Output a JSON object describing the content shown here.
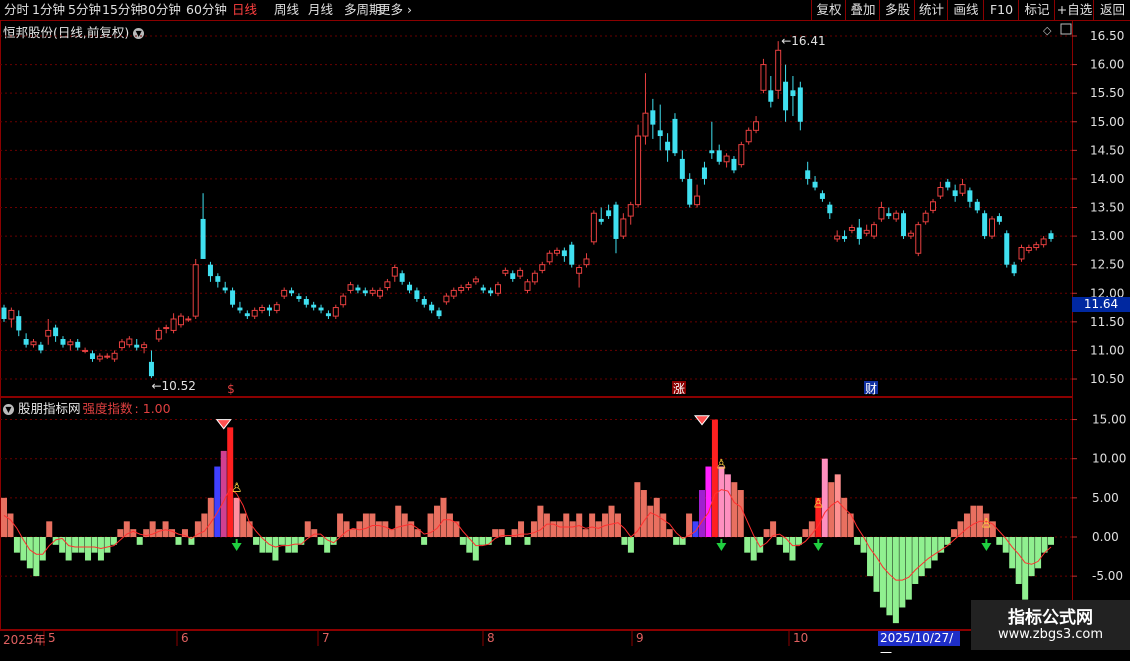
{
  "toolbar": {
    "periods": [
      "分时",
      "1分钟",
      "5分钟",
      "15分钟",
      "30分钟",
      "60分钟",
      "日线",
      "周线",
      "月线",
      "多周期",
      "更多"
    ],
    "active_period": "日线",
    "right_buttons": [
      "复权",
      "叠加",
      "多股",
      "统计",
      "画线",
      "F10",
      "标记",
      "+自选",
      "返回"
    ]
  },
  "header": {
    "stock_name": "恒邦股份",
    "mode": "(日线,前复权)"
  },
  "indicator": {
    "name": "股朋指标网",
    "series_name": "强度指数",
    "value": "1.00"
  },
  "price_panel": {
    "yticks": [
      "16.50",
      "16.00",
      "15.50",
      "15.00",
      "14.50",
      "14.00",
      "13.50",
      "13.00",
      "12.50",
      "12.00",
      "11.50",
      "11.00",
      "10.50"
    ],
    "current_price": "11.64",
    "high_label": "16.41",
    "low_label": "10.52",
    "event_marks": [
      "$",
      "涨",
      "财"
    ]
  },
  "indicator_panel": {
    "yticks": [
      "15.00",
      "10.00",
      "5.00",
      "0.00",
      "-5.00"
    ]
  },
  "dates": {
    "year_label": "2025年",
    "months": [
      "5",
      "6",
      "7",
      "8",
      "9",
      "10"
    ],
    "cursor": "2025/10/27/一"
  },
  "watermark": {
    "title": "指标公式网",
    "url": "www.zbgs3.com"
  },
  "colors": {
    "up": "#e84040",
    "down": "#40e0f0",
    "pos_bar": "#e87060",
    "neg_bar": "#90f090",
    "grid": "#7a0000"
  },
  "chart_data": [
    {
      "type": "candlestick",
      "title": "恒邦股份(日线,前复权)",
      "ylim": [
        10.3,
        16.7
      ],
      "grid": true,
      "candles": [
        [
          11.75,
          11.55,
          11.8,
          11.5
        ],
        [
          11.55,
          11.7,
          11.75,
          11.4
        ],
        [
          11.6,
          11.35,
          11.7,
          11.25
        ],
        [
          11.2,
          11.1,
          11.3,
          11.05
        ],
        [
          11.1,
          11.15,
          11.2,
          11.05
        ],
        [
          11.1,
          11.0,
          11.15,
          10.95
        ],
        [
          11.25,
          11.35,
          11.55,
          11.1
        ],
        [
          11.4,
          11.25,
          11.45,
          11.15
        ],
        [
          11.2,
          11.1,
          11.25,
          11.05
        ],
        [
          11.1,
          11.15,
          11.2,
          11.0
        ],
        [
          11.15,
          11.05,
          11.2,
          11.0
        ],
        [
          11.0,
          11.0,
          11.05,
          10.95
        ],
        [
          10.95,
          10.85,
          11.0,
          10.8
        ],
        [
          10.85,
          10.9,
          10.95,
          10.8
        ],
        [
          10.9,
          10.9,
          10.95,
          10.85
        ],
        [
          10.85,
          10.95,
          11.0,
          10.8
        ],
        [
          11.05,
          11.15,
          11.2,
          11.0
        ],
        [
          11.1,
          11.2,
          11.25,
          11.05
        ],
        [
          11.1,
          11.05,
          11.2,
          11.0
        ],
        [
          11.05,
          11.1,
          11.15,
          10.95
        ],
        [
          10.8,
          10.55,
          11.0,
          10.52
        ],
        [
          11.2,
          11.35,
          11.4,
          11.15
        ],
        [
          11.4,
          11.4,
          11.45,
          11.3
        ],
        [
          11.35,
          11.55,
          11.65,
          11.3
        ],
        [
          11.45,
          11.6,
          11.65,
          11.4
        ],
        [
          11.55,
          11.55,
          11.6,
          11.5
        ],
        [
          11.6,
          12.5,
          12.6,
          11.55
        ],
        [
          13.3,
          12.6,
          13.75,
          12.6
        ],
        [
          12.5,
          12.3,
          12.55,
          12.2
        ],
        [
          12.3,
          12.2,
          12.35,
          12.1
        ],
        [
          12.1,
          12.05,
          12.2,
          12.0
        ],
        [
          12.05,
          11.8,
          12.1,
          11.75
        ],
        [
          11.75,
          11.7,
          11.85,
          11.65
        ],
        [
          11.65,
          11.6,
          11.7,
          11.55
        ],
        [
          11.6,
          11.7,
          11.75,
          11.55
        ],
        [
          11.7,
          11.75,
          11.8,
          11.65
        ],
        [
          11.75,
          11.7,
          11.8,
          11.6
        ],
        [
          11.7,
          11.8,
          11.85,
          11.65
        ],
        [
          11.95,
          12.05,
          12.1,
          11.9
        ],
        [
          12.05,
          12.0,
          12.1,
          11.95
        ],
        [
          11.95,
          11.9,
          12.0,
          11.85
        ],
        [
          11.9,
          11.8,
          11.95,
          11.75
        ],
        [
          11.8,
          11.75,
          11.85,
          11.7
        ],
        [
          11.75,
          11.7,
          11.8,
          11.65
        ],
        [
          11.65,
          11.6,
          11.7,
          11.55
        ],
        [
          11.6,
          11.75,
          11.8,
          11.55
        ],
        [
          11.8,
          11.95,
          12.0,
          11.75
        ],
        [
          12.05,
          12.15,
          12.2,
          12.0
        ],
        [
          12.1,
          12.05,
          12.15,
          12.0
        ],
        [
          12.05,
          12.0,
          12.1,
          11.95
        ],
        [
          12.0,
          12.05,
          12.1,
          11.95
        ],
        [
          11.95,
          12.05,
          12.1,
          11.9
        ],
        [
          12.1,
          12.2,
          12.25,
          12.05
        ],
        [
          12.3,
          12.45,
          12.5,
          12.2
        ],
        [
          12.35,
          12.2,
          12.4,
          12.15
        ],
        [
          12.15,
          12.05,
          12.2,
          12.0
        ],
        [
          12.05,
          11.9,
          12.1,
          11.85
        ],
        [
          11.9,
          11.8,
          11.95,
          11.75
        ],
        [
          11.8,
          11.7,
          11.85,
          11.65
        ],
        [
          11.7,
          11.6,
          11.75,
          11.55
        ],
        [
          11.85,
          11.95,
          12.0,
          11.8
        ],
        [
          11.95,
          12.05,
          12.1,
          11.9
        ],
        [
          12.05,
          12.1,
          12.15,
          12.0
        ],
        [
          12.1,
          12.15,
          12.2,
          12.05
        ],
        [
          12.2,
          12.25,
          12.3,
          12.15
        ],
        [
          12.1,
          12.05,
          12.15,
          12.0
        ],
        [
          12.05,
          12.0,
          12.1,
          11.95
        ],
        [
          12.0,
          12.15,
          12.2,
          11.95
        ],
        [
          12.35,
          12.4,
          12.45,
          12.3
        ],
        [
          12.35,
          12.25,
          12.4,
          12.2
        ],
        [
          12.3,
          12.4,
          12.45,
          12.25
        ],
        [
          12.05,
          12.2,
          12.25,
          12.0
        ],
        [
          12.2,
          12.35,
          12.4,
          12.15
        ],
        [
          12.4,
          12.5,
          12.55,
          12.35
        ],
        [
          12.55,
          12.7,
          12.75,
          12.5
        ],
        [
          12.7,
          12.75,
          12.8,
          12.65
        ],
        [
          12.75,
          12.65,
          12.8,
          12.55
        ],
        [
          12.85,
          12.5,
          12.9,
          12.45
        ],
        [
          12.35,
          12.45,
          12.5,
          12.1
        ],
        [
          12.5,
          12.6,
          12.7,
          12.45
        ],
        [
          12.9,
          13.4,
          13.45,
          12.85
        ],
        [
          13.3,
          13.25,
          13.5,
          13.2
        ],
        [
          13.45,
          13.35,
          13.55,
          13.3
        ],
        [
          13.55,
          12.95,
          13.6,
          12.7
        ],
        [
          13.0,
          13.3,
          13.4,
          12.95
        ],
        [
          13.35,
          13.55,
          13.6,
          13.2
        ],
        [
          13.55,
          14.75,
          14.95,
          13.5
        ],
        [
          14.75,
          15.15,
          15.85,
          14.6
        ],
        [
          15.2,
          14.95,
          15.4,
          14.7
        ],
        [
          14.85,
          14.75,
          15.3,
          14.5
        ],
        [
          14.65,
          14.5,
          14.8,
          14.3
        ],
        [
          15.05,
          14.45,
          15.15,
          14.4
        ],
        [
          14.35,
          14.0,
          14.5,
          13.95
        ],
        [
          14.0,
          13.55,
          14.1,
          13.5
        ],
        [
          13.55,
          13.7,
          13.9,
          13.5
        ],
        [
          14.2,
          14.0,
          14.3,
          13.9
        ],
        [
          14.5,
          14.45,
          15.0,
          14.35
        ],
        [
          14.5,
          14.3,
          14.6,
          14.25
        ],
        [
          14.3,
          14.4,
          14.45,
          14.2
        ],
        [
          14.35,
          14.15,
          14.4,
          14.1
        ],
        [
          14.25,
          14.6,
          14.65,
          14.2
        ],
        [
          14.65,
          14.85,
          14.9,
          14.6
        ],
        [
          14.85,
          15.0,
          15.1,
          14.8
        ],
        [
          15.55,
          16.0,
          16.1,
          15.5
        ],
        [
          15.55,
          15.35,
          15.8,
          15.25
        ],
        [
          15.55,
          16.25,
          16.41,
          15.4
        ],
        [
          15.7,
          15.2,
          16.0,
          15.0
        ],
        [
          15.55,
          15.45,
          15.8,
          15.1
        ],
        [
          15.6,
          15.0,
          15.7,
          14.85
        ],
        [
          14.15,
          14.0,
          14.3,
          13.9
        ],
        [
          13.95,
          13.85,
          14.05,
          13.8
        ],
        [
          13.75,
          13.65,
          13.8,
          13.6
        ],
        [
          13.55,
          13.4,
          13.6,
          13.3
        ],
        [
          12.95,
          13.0,
          13.1,
          12.9
        ],
        [
          13.0,
          12.95,
          13.1,
          12.9
        ],
        [
          13.1,
          13.15,
          13.2,
          13.05
        ],
        [
          13.15,
          12.95,
          13.3,
          12.85
        ],
        [
          13.05,
          13.1,
          13.2,
          13.0
        ],
        [
          13.0,
          13.2,
          13.25,
          12.95
        ],
        [
          13.3,
          13.5,
          13.6,
          13.25
        ],
        [
          13.4,
          13.35,
          13.5,
          13.3
        ],
        [
          13.3,
          13.4,
          13.45,
          13.25
        ],
        [
          13.4,
          13.0,
          13.45,
          12.95
        ],
        [
          13.0,
          13.05,
          13.1,
          12.95
        ],
        [
          12.7,
          13.2,
          13.25,
          12.65
        ],
        [
          13.25,
          13.4,
          13.45,
          13.2
        ],
        [
          13.45,
          13.6,
          13.65,
          13.4
        ],
        [
          13.7,
          13.85,
          13.95,
          13.65
        ],
        [
          13.95,
          13.85,
          14.0,
          13.8
        ],
        [
          13.8,
          13.7,
          13.9,
          13.6
        ],
        [
          13.75,
          13.9,
          14.0,
          13.7
        ],
        [
          13.8,
          13.6,
          13.85,
          13.5
        ],
        [
          13.6,
          13.45,
          13.65,
          13.4
        ],
        [
          13.4,
          13.0,
          13.45,
          12.95
        ],
        [
          13.0,
          13.3,
          13.35,
          12.95
        ],
        [
          13.35,
          13.25,
          13.4,
          13.2
        ],
        [
          13.05,
          12.5,
          13.1,
          12.45
        ],
        [
          12.5,
          12.35,
          12.55,
          12.3
        ],
        [
          12.6,
          12.8,
          12.85,
          12.55
        ],
        [
          12.75,
          12.8,
          12.85,
          12.7
        ],
        [
          12.8,
          12.85,
          12.9,
          12.75
        ],
        [
          12.85,
          12.95,
          13.0,
          12.8
        ],
        [
          13.05,
          12.95,
          13.1,
          12.9
        ]
      ]
    },
    {
      "type": "bar",
      "series": [
        {
          "name": "强度指数",
          "values": [
            5,
            3,
            -2,
            -3,
            -4,
            -5,
            -3,
            2,
            -1,
            -2,
            -3,
            -2,
            -2,
            -3,
            -2,
            -3,
            -2,
            -1,
            1,
            2,
            1,
            -1,
            1,
            2,
            1,
            2,
            1,
            -1,
            1,
            -1,
            2,
            3,
            5,
            9,
            11,
            14,
            5,
            3,
            2,
            -1,
            -2,
            -2,
            -3,
            -1,
            -2,
            -2,
            -1,
            2,
            1,
            -1,
            -2,
            -1,
            3,
            2,
            1,
            2,
            3,
            3,
            2,
            2,
            1,
            4,
            3,
            2,
            1,
            -1,
            3,
            4,
            5,
            3,
            2,
            -1,
            -2,
            -3,
            -1,
            -1,
            1,
            1,
            -1,
            1,
            2,
            -1,
            2,
            4,
            3,
            2,
            2,
            3,
            2,
            3,
            1,
            3,
            2,
            3,
            4,
            3,
            -1,
            -2,
            7,
            6,
            4,
            5,
            3,
            1,
            -1,
            -1,
            3,
            2,
            6,
            9,
            15,
            9,
            8,
            7,
            6,
            -2,
            -3,
            -2,
            1,
            2,
            -1,
            -2,
            -3,
            -1,
            1,
            2,
            5,
            10,
            7,
            8,
            5,
            3,
            -1,
            -2,
            -5,
            -7,
            -9,
            -10,
            -11,
            -9,
            -8,
            -6,
            -5,
            -4,
            -3,
            -2,
            -1,
            1,
            2,
            3,
            4,
            4,
            3,
            2,
            -1,
            -2,
            -4,
            -6,
            -8,
            -5,
            -4,
            -2,
            -1
          ]
        },
        {
          "name": "MA",
          "values": []
        }
      ],
      "ylim": [
        -12,
        16
      ]
    }
  ]
}
